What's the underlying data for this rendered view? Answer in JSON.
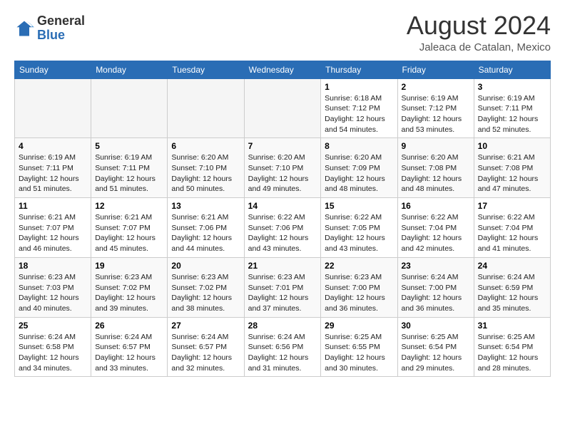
{
  "header": {
    "logo_general": "General",
    "logo_blue": "Blue",
    "month_year": "August 2024",
    "location": "Jaleaca de Catalan, Mexico"
  },
  "calendar": {
    "days_of_week": [
      "Sunday",
      "Monday",
      "Tuesday",
      "Wednesday",
      "Thursday",
      "Friday",
      "Saturday"
    ],
    "weeks": [
      [
        {
          "day": "",
          "info": ""
        },
        {
          "day": "",
          "info": ""
        },
        {
          "day": "",
          "info": ""
        },
        {
          "day": "",
          "info": ""
        },
        {
          "day": "1",
          "info": "Sunrise: 6:18 AM\nSunset: 7:12 PM\nDaylight: 12 hours\nand 54 minutes."
        },
        {
          "day": "2",
          "info": "Sunrise: 6:19 AM\nSunset: 7:12 PM\nDaylight: 12 hours\nand 53 minutes."
        },
        {
          "day": "3",
          "info": "Sunrise: 6:19 AM\nSunset: 7:11 PM\nDaylight: 12 hours\nand 52 minutes."
        }
      ],
      [
        {
          "day": "4",
          "info": "Sunrise: 6:19 AM\nSunset: 7:11 PM\nDaylight: 12 hours\nand 51 minutes."
        },
        {
          "day": "5",
          "info": "Sunrise: 6:19 AM\nSunset: 7:11 PM\nDaylight: 12 hours\nand 51 minutes."
        },
        {
          "day": "6",
          "info": "Sunrise: 6:20 AM\nSunset: 7:10 PM\nDaylight: 12 hours\nand 50 minutes."
        },
        {
          "day": "7",
          "info": "Sunrise: 6:20 AM\nSunset: 7:10 PM\nDaylight: 12 hours\nand 49 minutes."
        },
        {
          "day": "8",
          "info": "Sunrise: 6:20 AM\nSunset: 7:09 PM\nDaylight: 12 hours\nand 48 minutes."
        },
        {
          "day": "9",
          "info": "Sunrise: 6:20 AM\nSunset: 7:08 PM\nDaylight: 12 hours\nand 48 minutes."
        },
        {
          "day": "10",
          "info": "Sunrise: 6:21 AM\nSunset: 7:08 PM\nDaylight: 12 hours\nand 47 minutes."
        }
      ],
      [
        {
          "day": "11",
          "info": "Sunrise: 6:21 AM\nSunset: 7:07 PM\nDaylight: 12 hours\nand 46 minutes."
        },
        {
          "day": "12",
          "info": "Sunrise: 6:21 AM\nSunset: 7:07 PM\nDaylight: 12 hours\nand 45 minutes."
        },
        {
          "day": "13",
          "info": "Sunrise: 6:21 AM\nSunset: 7:06 PM\nDaylight: 12 hours\nand 44 minutes."
        },
        {
          "day": "14",
          "info": "Sunrise: 6:22 AM\nSunset: 7:06 PM\nDaylight: 12 hours\nand 43 minutes."
        },
        {
          "day": "15",
          "info": "Sunrise: 6:22 AM\nSunset: 7:05 PM\nDaylight: 12 hours\nand 43 minutes."
        },
        {
          "day": "16",
          "info": "Sunrise: 6:22 AM\nSunset: 7:04 PM\nDaylight: 12 hours\nand 42 minutes."
        },
        {
          "day": "17",
          "info": "Sunrise: 6:22 AM\nSunset: 7:04 PM\nDaylight: 12 hours\nand 41 minutes."
        }
      ],
      [
        {
          "day": "18",
          "info": "Sunrise: 6:23 AM\nSunset: 7:03 PM\nDaylight: 12 hours\nand 40 minutes."
        },
        {
          "day": "19",
          "info": "Sunrise: 6:23 AM\nSunset: 7:02 PM\nDaylight: 12 hours\nand 39 minutes."
        },
        {
          "day": "20",
          "info": "Sunrise: 6:23 AM\nSunset: 7:02 PM\nDaylight: 12 hours\nand 38 minutes."
        },
        {
          "day": "21",
          "info": "Sunrise: 6:23 AM\nSunset: 7:01 PM\nDaylight: 12 hours\nand 37 minutes."
        },
        {
          "day": "22",
          "info": "Sunrise: 6:23 AM\nSunset: 7:00 PM\nDaylight: 12 hours\nand 36 minutes."
        },
        {
          "day": "23",
          "info": "Sunrise: 6:24 AM\nSunset: 7:00 PM\nDaylight: 12 hours\nand 36 minutes."
        },
        {
          "day": "24",
          "info": "Sunrise: 6:24 AM\nSunset: 6:59 PM\nDaylight: 12 hours\nand 35 minutes."
        }
      ],
      [
        {
          "day": "25",
          "info": "Sunrise: 6:24 AM\nSunset: 6:58 PM\nDaylight: 12 hours\nand 34 minutes."
        },
        {
          "day": "26",
          "info": "Sunrise: 6:24 AM\nSunset: 6:57 PM\nDaylight: 12 hours\nand 33 minutes."
        },
        {
          "day": "27",
          "info": "Sunrise: 6:24 AM\nSunset: 6:57 PM\nDaylight: 12 hours\nand 32 minutes."
        },
        {
          "day": "28",
          "info": "Sunrise: 6:24 AM\nSunset: 6:56 PM\nDaylight: 12 hours\nand 31 minutes."
        },
        {
          "day": "29",
          "info": "Sunrise: 6:25 AM\nSunset: 6:55 PM\nDaylight: 12 hours\nand 30 minutes."
        },
        {
          "day": "30",
          "info": "Sunrise: 6:25 AM\nSunset: 6:54 PM\nDaylight: 12 hours\nand 29 minutes."
        },
        {
          "day": "31",
          "info": "Sunrise: 6:25 AM\nSunset: 6:54 PM\nDaylight: 12 hours\nand 28 minutes."
        }
      ]
    ]
  }
}
